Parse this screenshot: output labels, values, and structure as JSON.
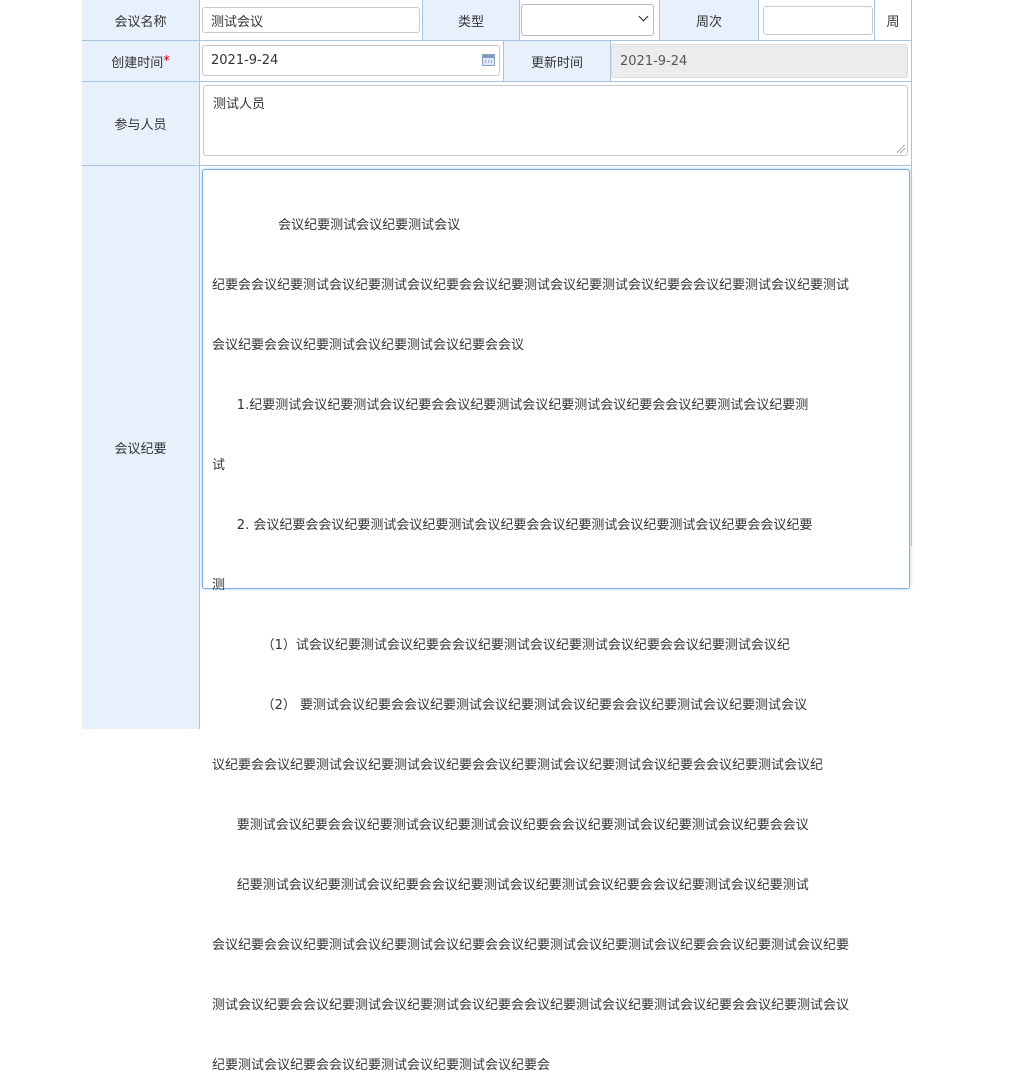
{
  "form": {
    "meeting_name": {
      "label": "会议名称",
      "value": "测试会议"
    },
    "type": {
      "label": "类型",
      "value": ""
    },
    "week": {
      "label": "周次",
      "value": "",
      "unit": "周"
    },
    "created": {
      "label": "创建时间",
      "required_mark": "*",
      "value": "2021-9-24"
    },
    "updated": {
      "label": "更新时间",
      "value": "2021-9-24"
    },
    "participants": {
      "label": "参与人员",
      "value": "测试人员"
    },
    "minutes": {
      "label": "会议纪要",
      "lines": [
        "                会议纪要测试会议纪要测试会议",
        "纪要会会议纪要测试会议纪要测试会议纪要会会议纪要测试会议纪要测试会议纪要会会议纪要测试会议纪要测试",
        "会议纪要会会议纪要测试会议纪要测试会议纪要会会议",
        "      1.纪要测试会议纪要测试会议纪要会会议纪要测试会议纪要测试会议纪要会会议纪要测试会议纪要测",
        "试",
        "      2. 会议纪要会会议纪要测试会议纪要测试会议纪要会会议纪要测试会议纪要测试会议纪要会会议纪要",
        "测",
        "            （1）试会议纪要测试会议纪要会会议纪要测试会议纪要测试会议纪要会会议纪要测试会议纪",
        "            （2） 要测试会议纪要会会议纪要测试会议纪要测试会议纪要会会议纪要测试会议纪要测试会议",
        "议纪要会会议纪要测试会议纪要测试会议纪要会会议纪要测试会议纪要测试会议纪要会会议纪要测试会议纪",
        "      要测试会议纪要会会议纪要测试会议纪要测试会议纪要会会议纪要测试会议纪要测试会议纪要会会议",
        "      纪要测试会议纪要测试会议纪要会会议纪要测试会议纪要测试会议纪要会会议纪要测试会议纪要测试",
        "会议纪要会会议纪要测试会议纪要测试会议纪要会会议纪要测试会议纪要测试会议纪要会会议纪要测试会议纪要",
        "测试会议纪要会会议纪要测试会议纪要测试会议纪要会会议纪要测试会议纪要测试会议纪要会会议纪要测试会议",
        "纪要测试会议纪要会会议纪要测试会议纪要测试会议纪要会"
      ]
    }
  },
  "colors": {
    "label_bg": "#e7f0fb",
    "border": "#a9c3e3",
    "required": "#e60000"
  }
}
